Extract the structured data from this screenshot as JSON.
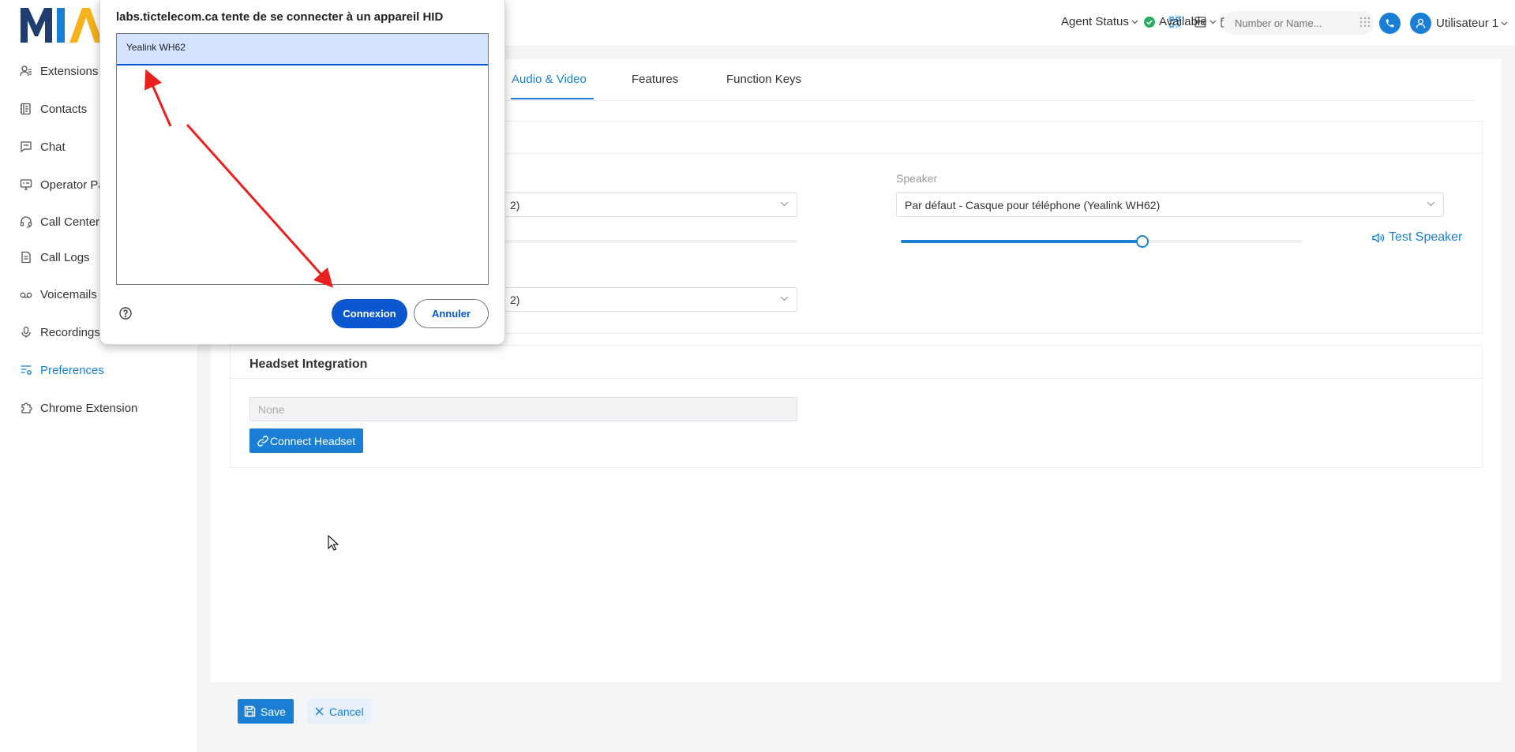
{
  "brand": {
    "logo_text": "MIA",
    "colors": {
      "primary": "#1a7fd4",
      "logo_dark": "#1f3d6e",
      "logo_accent": "#f5b21b",
      "dialog_blue": "#0b57d0",
      "annotation_red": "#e8201e"
    }
  },
  "sidebar": {
    "items": [
      {
        "label": "Extensions",
        "icon": "user-list-icon"
      },
      {
        "label": "Contacts",
        "icon": "address-book-icon"
      },
      {
        "label": "Chat",
        "icon": "chat-bubble-icon"
      },
      {
        "label": "Operator Pa",
        "icon": "monitor-icon"
      },
      {
        "label": "Call Center",
        "icon": "headset-icon"
      },
      {
        "label": "Call Logs",
        "icon": "document-log-icon"
      },
      {
        "label": "Voicemails",
        "icon": "voicemail-icon"
      },
      {
        "label": "Recordings",
        "icon": "microphone-icon"
      },
      {
        "label": "Preferences",
        "icon": "preferences-icon",
        "active": true
      },
      {
        "label": "Chrome Extension",
        "icon": "puzzle-icon"
      }
    ]
  },
  "header": {
    "agent_status_label": "Agent Status",
    "availability_label": "Available",
    "dial_placeholder": "Number or Name...",
    "user_name": "Utilisateur 1"
  },
  "tabs": [
    {
      "label": "Audio & Video",
      "active": true
    },
    {
      "label": "Features"
    },
    {
      "label": "Function Keys"
    }
  ],
  "audio": {
    "microphone_select_partial": "2)",
    "ringtone_select_partial": "2)",
    "speaker_label": "Speaker",
    "speaker_value": "Par défaut - Casque pour téléphone (Yealink WH62)",
    "speaker_volume_fraction": 0.6,
    "test_speaker_label": "Test Speaker"
  },
  "headset": {
    "title": "Headset Integration",
    "current_value": "None",
    "connect_label": "Connect Headset"
  },
  "footer": {
    "save_label": "Save",
    "cancel_label": "Cancel"
  },
  "hid_dialog": {
    "title": "labs.tictelecom.ca tente de se connecter à un appareil HID",
    "devices": [
      "Yealink WH62"
    ],
    "connect_label": "Connexion",
    "cancel_label": "Annuler"
  }
}
